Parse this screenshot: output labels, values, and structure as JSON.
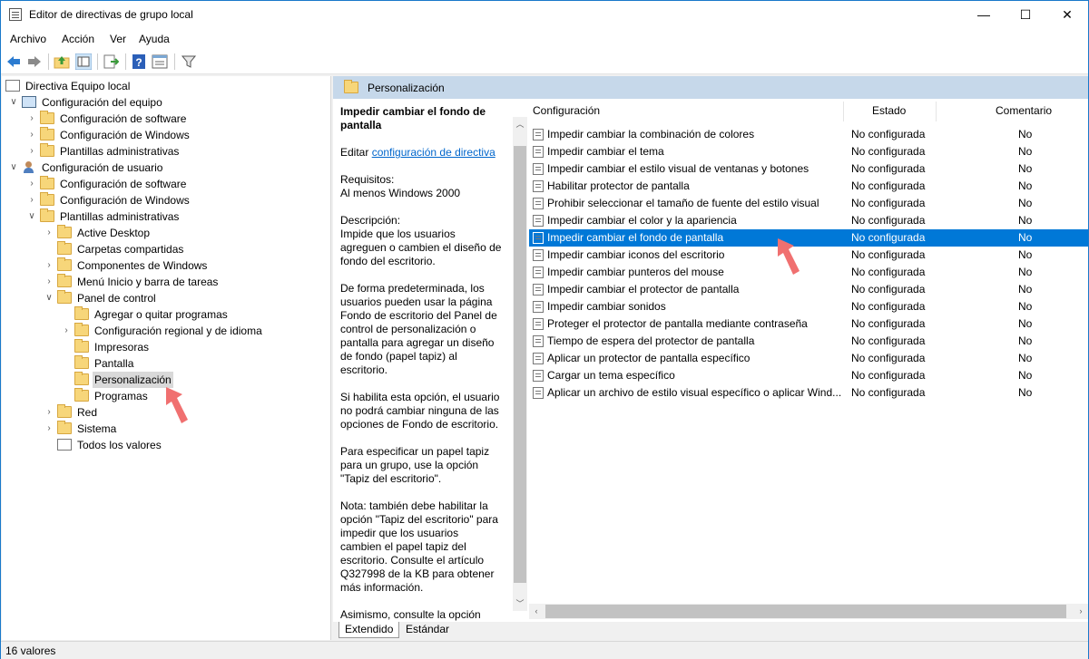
{
  "window": {
    "title": "Editor de directivas de grupo local"
  },
  "menu": [
    "Archivo",
    "Acción",
    "Ver",
    "Ayuda"
  ],
  "toolbar_icons": [
    "back-icon",
    "forward-icon",
    "up-folder-icon",
    "show-hide-tree-icon",
    "export-list-icon",
    "help-icon",
    "properties-icon",
    "filter-icon"
  ],
  "tree": [
    {
      "label": "Directiva Equipo local",
      "level": 0,
      "icon": "book",
      "twist": ""
    },
    {
      "label": "Configuración del equipo",
      "level": 1,
      "icon": "pc",
      "twist": "∨"
    },
    {
      "label": "Configuración de software",
      "level": 2,
      "icon": "folder",
      "twist": "›"
    },
    {
      "label": "Configuración de Windows",
      "level": 2,
      "icon": "folder",
      "twist": "›"
    },
    {
      "label": "Plantillas administrativas",
      "level": 2,
      "icon": "folder",
      "twist": "›"
    },
    {
      "label": "Configuración de usuario",
      "level": 1,
      "icon": "user",
      "twist": "∨"
    },
    {
      "label": "Configuración de software",
      "level": 2,
      "icon": "folder",
      "twist": "›"
    },
    {
      "label": "Configuración de Windows",
      "level": 2,
      "icon": "folder",
      "twist": "›"
    },
    {
      "label": "Plantillas administrativas",
      "level": 2,
      "icon": "folder",
      "twist": "∨"
    },
    {
      "label": "Active Desktop",
      "level": 3,
      "icon": "folder",
      "twist": "›"
    },
    {
      "label": "Carpetas compartidas",
      "level": 3,
      "icon": "folder",
      "twist": ""
    },
    {
      "label": "Componentes de Windows",
      "level": 3,
      "icon": "folder",
      "twist": "›"
    },
    {
      "label": "Menú Inicio y barra de tareas",
      "level": 3,
      "icon": "folder",
      "twist": "›"
    },
    {
      "label": "Panel de control",
      "level": 3,
      "icon": "folder",
      "twist": "∨"
    },
    {
      "label": "Agregar o quitar programas",
      "level": 4,
      "icon": "folder",
      "twist": ""
    },
    {
      "label": "Configuración regional y de idioma",
      "level": 4,
      "icon": "folder",
      "twist": "›"
    },
    {
      "label": "Impresoras",
      "level": 4,
      "icon": "folder",
      "twist": ""
    },
    {
      "label": "Pantalla",
      "level": 4,
      "icon": "folder",
      "twist": ""
    },
    {
      "label": "Personalización",
      "level": 4,
      "icon": "folder",
      "twist": "",
      "selected": true
    },
    {
      "label": "Programas",
      "level": 4,
      "icon": "folder",
      "twist": ""
    },
    {
      "label": "Red",
      "level": 3,
      "icon": "folder",
      "twist": "›"
    },
    {
      "label": "Sistema",
      "level": 3,
      "icon": "folder",
      "twist": "›"
    },
    {
      "label": "Todos los valores",
      "level": 3,
      "icon": "book",
      "twist": ""
    }
  ],
  "panel": {
    "header": "Personalización",
    "desc_title": "Impedir cambiar el fondo de pantalla",
    "edit_prefix": "Editar ",
    "edit_link": "configuración de directiva",
    "requirements": "Requisitos:\nAl menos Windows 2000",
    "description": "Descripción:\nImpide que los usuarios agreguen o cambien el diseño de fondo del escritorio.",
    "p1": "De forma predeterminada, los usuarios pueden usar la página Fondo de escritorio del Panel de control de personalización o pantalla para agregar un diseño de fondo (papel tapiz) al escritorio.",
    "p2": "Si habilita esta opción, el usuario no podrá cambiar ninguna de las opciones de Fondo de escritorio.",
    "p3": "Para especificar un papel tapiz para un grupo, use la opción \"Tapiz del escritorio\".",
    "p4": "Nota: también debe habilitar la opción \"Tapiz del escritorio\" para impedir que los usuarios cambien el papel tapiz del escritorio. Consulte el artículo Q327998 de la KB para obtener más información.",
    "p5": "Asimismo, consulte la opción \"Permitir solo papel tapiz de mapa de bits\"."
  },
  "columns": {
    "config": "Configuración",
    "state": "Estado",
    "comment": "Comentario"
  },
  "rows": [
    {
      "name": "Impedir cambiar la combinación de colores",
      "state": "No configurada",
      "comment": "No"
    },
    {
      "name": "Impedir cambiar el tema",
      "state": "No configurada",
      "comment": "No"
    },
    {
      "name": "Impedir cambiar el estilo visual de ventanas y botones",
      "state": "No configurada",
      "comment": "No"
    },
    {
      "name": "Habilitar protector de pantalla",
      "state": "No configurada",
      "comment": "No"
    },
    {
      "name": "Prohibir seleccionar el tamaño de fuente del estilo visual",
      "state": "No configurada",
      "comment": "No"
    },
    {
      "name": "Impedir cambiar el color y la apariencia",
      "state": "No configurada",
      "comment": "No"
    },
    {
      "name": "Impedir cambiar el fondo de pantalla",
      "state": "No configurada",
      "comment": "No",
      "selected": true
    },
    {
      "name": "Impedir cambiar iconos del escritorio",
      "state": "No configurada",
      "comment": "No"
    },
    {
      "name": "Impedir cambiar punteros del mouse",
      "state": "No configurada",
      "comment": "No"
    },
    {
      "name": "Impedir cambiar el protector de pantalla",
      "state": "No configurada",
      "comment": "No"
    },
    {
      "name": "Impedir cambiar sonidos",
      "state": "No configurada",
      "comment": "No"
    },
    {
      "name": "Proteger el protector de pantalla mediante contraseña",
      "state": "No configurada",
      "comment": "No"
    },
    {
      "name": "Tiempo de espera del protector de pantalla",
      "state": "No configurada",
      "comment": "No"
    },
    {
      "name": "Aplicar un protector de pantalla específico",
      "state": "No configurada",
      "comment": "No"
    },
    {
      "name": "Cargar un tema específico",
      "state": "No configurada",
      "comment": "No"
    },
    {
      "name": "Aplicar un archivo de estilo visual específico o aplicar Wind...",
      "state": "No configurada",
      "comment": "No"
    }
  ],
  "tabs": [
    "Extendido",
    "Estándar"
  ],
  "status": "16 valores",
  "colors": {
    "selection": "#0078d7",
    "header_strip": "#c6d8ea",
    "annotation_arrow": "#f07070"
  }
}
